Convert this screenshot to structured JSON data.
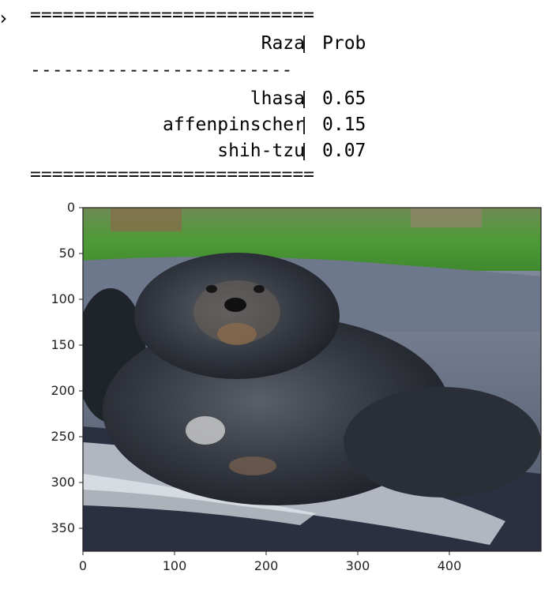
{
  "output": {
    "prompt_glyph": "›",
    "rule_top": "==========================",
    "rule_mid": "------------------------",
    "rule_bottom": "==========================",
    "table": {
      "headers": [
        "Raza",
        "Prob"
      ],
      "rows": [
        {
          "breed": "lhasa",
          "prob": "0.65"
        },
        {
          "breed": "affenpinscher",
          "prob": "0.15"
        },
        {
          "breed": "shih-tzu",
          "prob": "0.07"
        }
      ]
    }
  },
  "image_plot": {
    "subject": "dog photo",
    "x_ticks": [
      "0",
      "100",
      "200",
      "300",
      "400"
    ],
    "y_ticks": [
      "0",
      "50",
      "100",
      "150",
      "200",
      "250",
      "300",
      "350"
    ],
    "x_range": [
      0,
      500
    ],
    "y_range": [
      0,
      375
    ]
  }
}
